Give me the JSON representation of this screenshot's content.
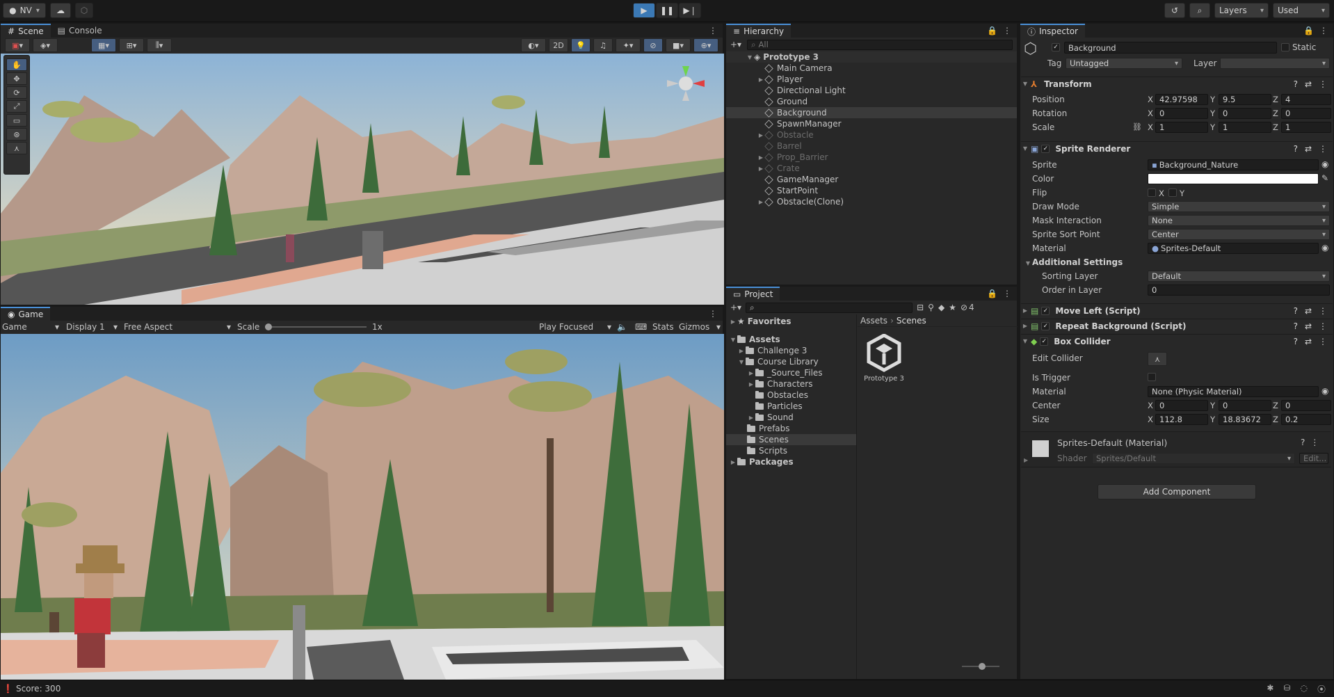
{
  "topbar": {
    "account": "NV",
    "layers": "Layers",
    "layout": "Used"
  },
  "scene_tabs": {
    "scene": "Scene",
    "console": "Console"
  },
  "scene_toolbar": {
    "mode_2d": "2D"
  },
  "game": {
    "tab": "Game",
    "display_mode": "Game",
    "display": "Display 1",
    "aspect": "Free Aspect",
    "scale_label": "Scale",
    "scale_value": "1x",
    "play_focused": "Play Focused",
    "stats": "Stats",
    "gizmos": "Gizmos"
  },
  "hierarchy": {
    "tab": "Hierarchy",
    "search_placeholder": "All",
    "scene": "Prototype 3",
    "items": [
      "Main Camera",
      "Player",
      "Directional Light",
      "Ground",
      "Background",
      "SpawnManager",
      "Obstacle",
      "Barrel",
      "Prop_Barrier",
      "Crate",
      "GameManager",
      "StartPoint",
      "Obstacle(Clone)"
    ]
  },
  "project": {
    "tab": "Project",
    "hidden_count": "4",
    "favorites": "Favorites",
    "assets": "Assets",
    "challenge": "Challenge 3",
    "course_library": "Course Library",
    "source_files": "_Source_Files",
    "characters": "Characters",
    "obstacles": "Obstacles",
    "particles": "Particles",
    "sound": "Sound",
    "prefabs": "Prefabs",
    "scenes": "Scenes",
    "scripts": "Scripts",
    "packages": "Packages",
    "breadcrumb_root": "Assets",
    "breadcrumb_current": "Scenes",
    "asset_name": "Prototype 3"
  },
  "inspector": {
    "tab": "Inspector",
    "object_name": "Background",
    "static_label": "Static",
    "tag_label": "Tag",
    "tag_value": "Untagged",
    "layer_label": "Layer",
    "transform": {
      "title": "Transform",
      "position_label": "Position",
      "rotation_label": "Rotation",
      "scale_label": "Scale",
      "pos_x": "42.97598",
      "pos_y": "9.5",
      "pos_z": "4",
      "rot_x": "0",
      "rot_y": "0",
      "rot_z": "0",
      "scale_x": "1",
      "scale_y": "1",
      "scale_z": "1"
    },
    "sprite_renderer": {
      "title": "Sprite Renderer",
      "sprite_label": "Sprite",
      "sprite_value": "Background_Nature",
      "color_label": "Color",
      "color_value": "#ffffff",
      "flip_label": "Flip",
      "flip_x": "X",
      "flip_y": "Y",
      "draw_mode_label": "Draw Mode",
      "draw_mode": "Simple",
      "mask_label": "Mask Interaction",
      "mask_value": "None",
      "sort_point_label": "Sprite Sort Point",
      "sort_point": "Center",
      "material_label": "Material",
      "material_value": "Sprites-Default",
      "additional": "Additional Settings",
      "sorting_layer_label": "Sorting Layer",
      "sorting_layer": "Default",
      "order_label": "Order in Layer",
      "order_value": "0"
    },
    "move_left": "Move Left (Script)",
    "repeat_bg": "Repeat Background (Script)",
    "box_collider": {
      "title": "Box Collider",
      "edit_label": "Edit Collider",
      "trigger_label": "Is Trigger",
      "material_label": "Material",
      "material_value": "None (Physic Material)",
      "center_label": "Center",
      "center_x": "0",
      "center_y": "0",
      "center_z": "0",
      "size_label": "Size",
      "size_x": "112.8",
      "size_y": "18.83672",
      "size_z": "0.2"
    },
    "material_card": {
      "name": "Sprites-Default (Material)",
      "shader_label": "Shader",
      "shader_value": "Sprites/Default",
      "edit": "Edit..."
    },
    "add_component": "Add Component"
  },
  "axis": {
    "x": "X",
    "y": "Y",
    "z": "Z"
  },
  "status": {
    "text": "Score: 300"
  },
  "colors": {
    "accent": "#3b79b5",
    "panel": "#282828",
    "dark": "#191919",
    "sky_top": "#6d9cc5",
    "sky_bottom": "#e8e0c4",
    "rock": "#bfa08f",
    "tree": "#3e6d3b",
    "ground": "#d9d9d9"
  }
}
